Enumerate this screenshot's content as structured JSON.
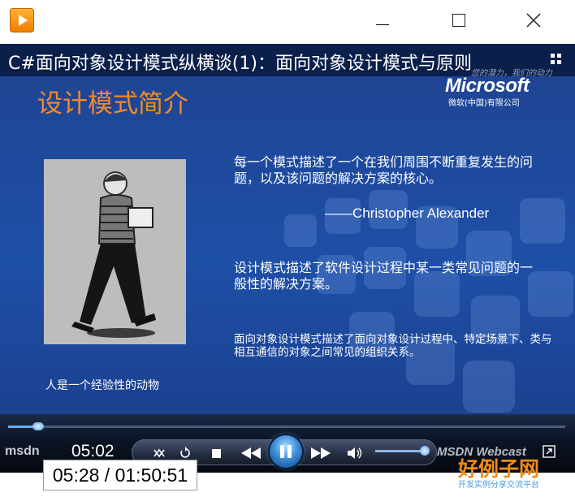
{
  "window": {
    "app_icon": "media-player-app-icon",
    "controls": [
      "minimize-icon",
      "maximize-icon",
      "close-icon"
    ]
  },
  "slide": {
    "header_title": "C#面向对象设计模式纵横谈(1)：面向对象设计模式与原则",
    "tagline": "您的潜力，我们的动力",
    "logo_text": "Microsoft",
    "logo_sub": "微软(中国)有限公司",
    "section_title": "设计模式简介",
    "quote": "每一个模式描述了一个在我们周围不断重复发生的问题，以及该问题的解决方案的核心。",
    "quote_author": "——Christopher Alexander",
    "definition_1": "设计模式描述了软件设计过程中某一类常见问题的一般性的解决方案。",
    "definition_2": "面向对象设计模式描述了面向对象设计过程中、特定场景下、类与相互通信的对象之间常见的组织关系。",
    "photo_caption": "人是一个经验性的动物",
    "colors": {
      "title_orange": "#f08a2c",
      "slide_blue": "#1e4fa7",
      "header_dark": "#0a1f4a"
    }
  },
  "player": {
    "brand_left": "msdn",
    "current_time": "05:02",
    "seek_progress": 0.054,
    "volume_level": 0.85,
    "brand_right": "MSDN Webcast",
    "buttons": [
      "shuffle-icon",
      "repeat-icon",
      "stop-icon",
      "previous-icon",
      "pause-icon",
      "next-icon",
      "volume-icon",
      "fullscreen-icon"
    ],
    "colors": {
      "accent": "#4e9ee6"
    }
  },
  "tooltip": {
    "time_text": "05:28 / 01:50:51"
  },
  "watermark": {
    "brand": "好例子网",
    "sub": "开发实例分享交流平台"
  }
}
